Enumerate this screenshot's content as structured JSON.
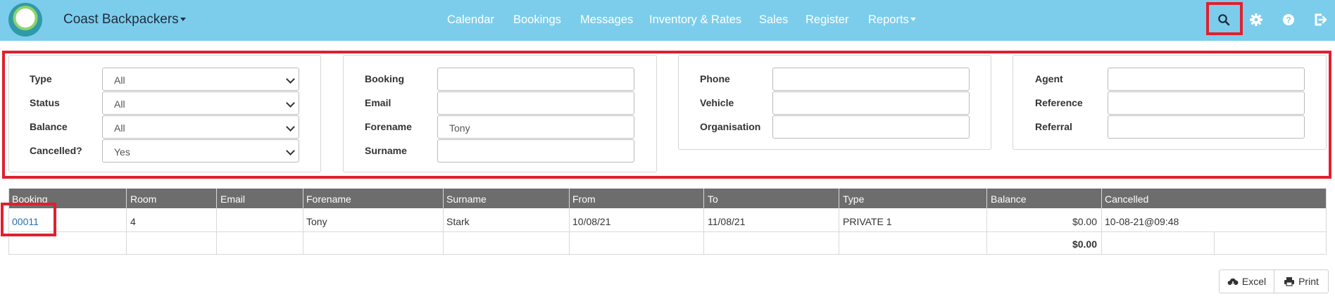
{
  "brand": "Coast Backpackers",
  "nav": [
    "Calendar",
    "Bookings",
    "Messages",
    "Inventory & Rates",
    "Sales",
    "Register",
    "Reports"
  ],
  "header_icons": [
    "search-icon",
    "gear-icon",
    "help-icon",
    "logout-icon"
  ],
  "filters": {
    "panel1": {
      "type_label": "Type",
      "type_value": "All",
      "status_label": "Status",
      "status_value": "All",
      "balance_label": "Balance",
      "balance_value": "All",
      "cancelled_label": "Cancelled?",
      "cancelled_value": "Yes"
    },
    "panel2": {
      "booking_label": "Booking",
      "booking_value": "",
      "email_label": "Email",
      "email_value": "",
      "forename_label": "Forename",
      "forename_value": "Tony",
      "surname_label": "Surname",
      "surname_value": ""
    },
    "panel3": {
      "phone_label": "Phone",
      "phone_value": "",
      "vehicle_label": "Vehicle",
      "vehicle_value": "",
      "organisation_label": "Organisation",
      "organisation_value": ""
    },
    "panel4": {
      "agent_label": "Agent",
      "agent_value": "",
      "reference_label": "Reference",
      "reference_value": "",
      "referral_label": "Referral",
      "referral_value": ""
    }
  },
  "table": {
    "columns": [
      "Booking",
      "Room",
      "Email",
      "Forename",
      "Surname",
      "From",
      "To",
      "Type",
      "Balance",
      "Cancelled"
    ],
    "rows": [
      {
        "booking": "00011",
        "room": "4",
        "email": "",
        "forename": "Tony",
        "surname": "Stark",
        "from": "10/08/21",
        "to": "11/08/21",
        "type": "PRIVATE 1",
        "balance": "$0.00",
        "cancelled": "10-08-21@09:48"
      }
    ],
    "total_balance": "$0.00"
  },
  "buttons": {
    "excel": "Excel",
    "print": "Print"
  },
  "colors": {
    "navbar": "#7ccdec",
    "highlight": "#e0202e",
    "table_header": "#6d6d6d",
    "link": "#2a6fb0"
  }
}
